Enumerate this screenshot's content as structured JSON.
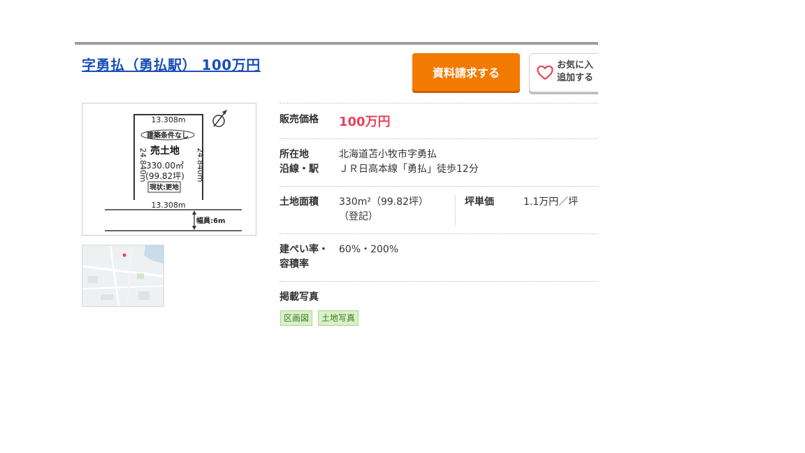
{
  "listing": {
    "title": "字勇払（勇払駅） 100万円",
    "request_button": "資料請求する",
    "favorite_button": {
      "line1": "お気に入",
      "line2": "追加する"
    }
  },
  "floor_plan": {
    "top_width": "13.308m",
    "bottom_width": "13.308m",
    "left_depth": "24.840m",
    "right_depth": "24.840m",
    "condition_label": "建築条件なし",
    "land_type": "売土地",
    "area": "330.00㎡",
    "tsubo": "(99.82坪)",
    "status": "現状:更地",
    "road_width": "幅員:6m"
  },
  "details": {
    "price_label": "販売価格",
    "price_value": "100万円",
    "address_label": "所在地",
    "address_value": "北海道苫小牧市字勇払",
    "line_label": "沿線・駅",
    "line_value": "ＪＲ日高本線「勇払」徒歩12分",
    "land_area_label": "土地面積",
    "land_area_value": "330m²（99.82坪）",
    "land_area_note": "（登記）",
    "tsubo_price_label": "坪単価",
    "tsubo_price_value": "1.1万円／坪",
    "ratio_label_1": "建ぺい率・",
    "ratio_label_2": "容積率",
    "ratio_value": "60%・200%",
    "photos_label": "掲載写真",
    "photo_tags": [
      "区画図",
      "土地写真"
    ]
  },
  "colors": {
    "title_link": "#1a4fb8",
    "request_button": "#f37a00",
    "price": "#e8435a",
    "tag_bg": "#d9f0c9",
    "tag_text": "#3d7b1f",
    "top_rule": "#9e9e9e"
  }
}
